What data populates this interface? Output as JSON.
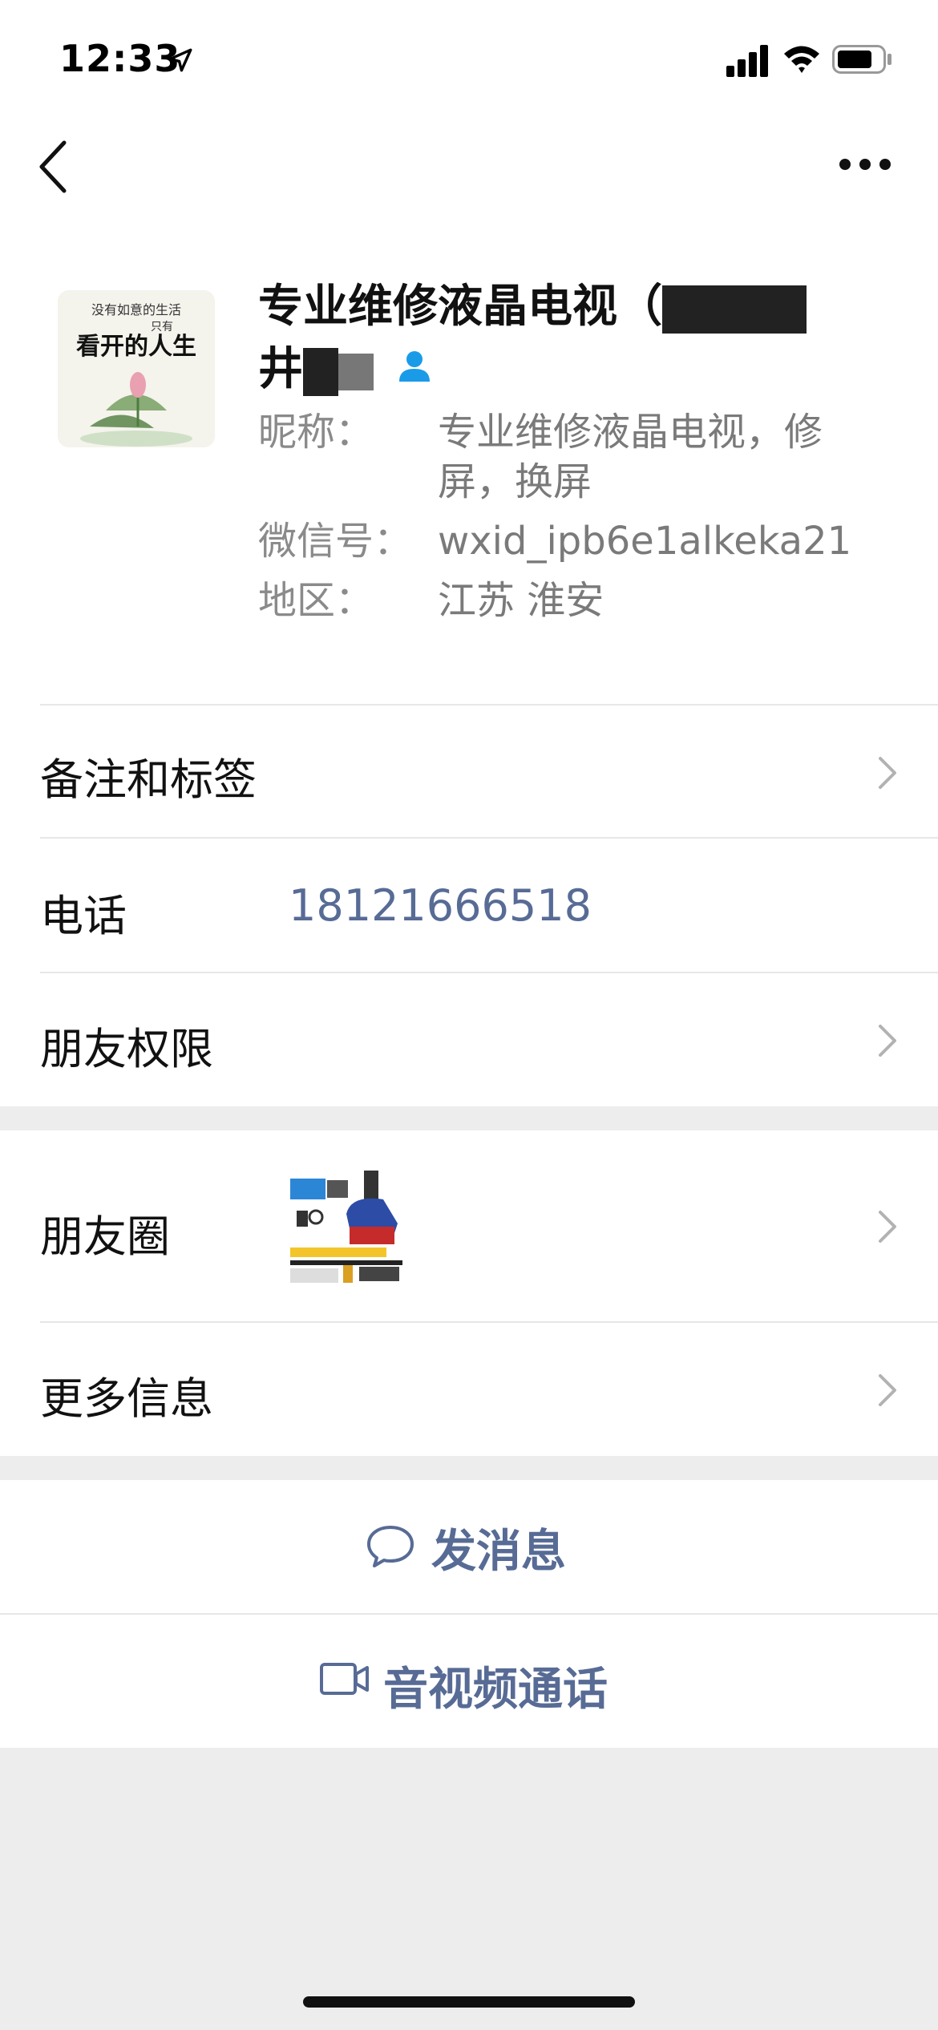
{
  "status_bar": {
    "time": "12:33"
  },
  "profile": {
    "name": "专业维修液晶电视（",
    "name_line2": "井",
    "nickname_label": "昵称：",
    "nickname_value": "专业维修液晶电视，修屏，换屏",
    "wechat_id_label": "微信号：",
    "wechat_id_value": "wxid_ipb6e1alkeka21",
    "region_label": "地区：",
    "region_value": "江苏 淮安",
    "avatar_text_top": "没有如意的生活",
    "avatar_text_mid": "只有",
    "avatar_text_main": "看开的人生"
  },
  "cells": {
    "remarks_label": "备注和标签",
    "phone_label": "电话",
    "phone_value": "18121666518",
    "permissions_label": "朋友权限",
    "moments_label": "朋友圈",
    "more_info_label": "更多信息"
  },
  "actions": {
    "message_label": "发消息",
    "video_call_label": "音视频通话"
  },
  "colors": {
    "link": "#576b95",
    "background": "#ededed",
    "card": "#ffffff"
  },
  "icons": [
    "back-arrow-icon",
    "more-icon",
    "person-icon",
    "chevron-right-icon",
    "chat-bubble-icon",
    "video-camera-icon",
    "location-arrow-icon",
    "signal-icon",
    "wifi-icon",
    "battery-icon"
  ]
}
